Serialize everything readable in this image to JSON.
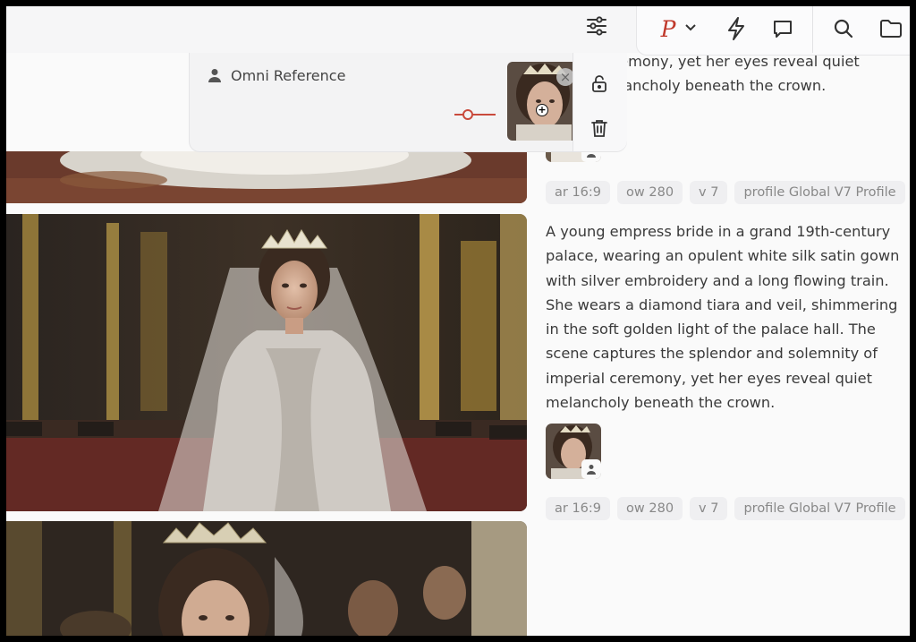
{
  "toolbar": {
    "icons": [
      "sliders-icon",
      "personalize-p-icon",
      "chevron-down-icon",
      "lightning-icon",
      "chat-icon",
      "search-icon",
      "folder-icon"
    ],
    "profile_letter": "P",
    "accent": "#c0392b"
  },
  "omni_reference": {
    "title": "Omni Reference",
    "weight_color": "#c94a3c",
    "close_symbol": "×",
    "zoom_symbol": "+"
  },
  "feed": {
    "top_prompt": "ceremony, yet her eyes reveal quiet\nmelancholy beneath the crown.",
    "main_prompt": "A young empress bride in a grand 19th-century palace, wearing an opulent white silk satin gown with silver embroidery and a long flowing train. She wears a diamond tiara and veil, shimmering in the soft golden light of the palace hall. The scene captures the splendor and solemnity of imperial ceremony, yet her eyes reveal quiet melancholy beneath the crown.",
    "params_top": [
      "ar 16:9",
      "ow 280",
      "v 7",
      "profile Global V7 Profile"
    ],
    "params_main": [
      "ar 16:9",
      "ow 280",
      "v 7",
      "profile Global V7 Profile"
    ]
  }
}
